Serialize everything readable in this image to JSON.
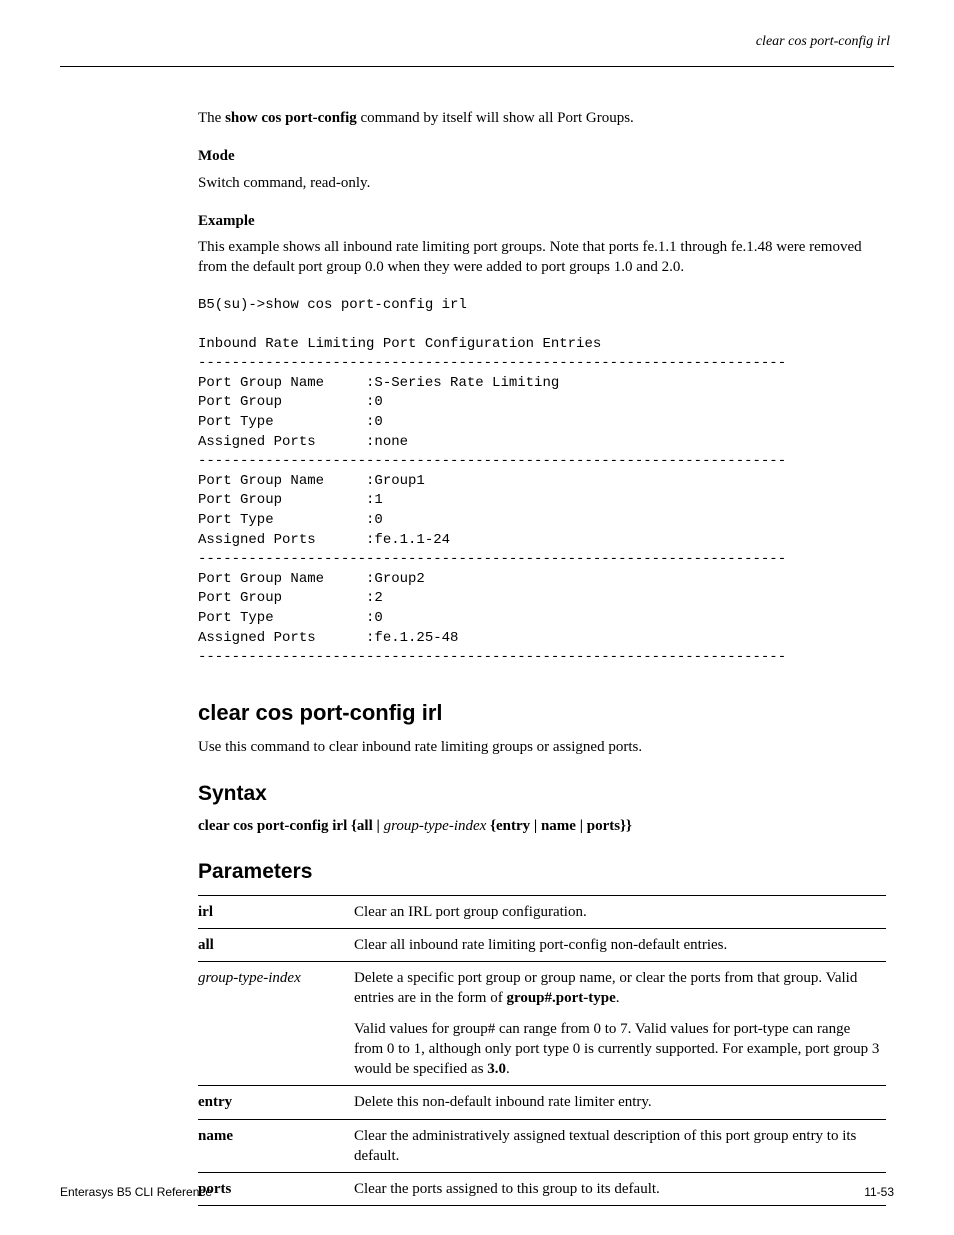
{
  "header": {
    "right": "clear cos port-config irl"
  },
  "body": {
    "intro_prefix": "The ",
    "intro_cmd": "show cos port-config",
    "intro_suffix": " command by itself will show all Port Groups.",
    "mode_h": "Mode",
    "mode_text": "Switch command, read-only.",
    "example_h": "Example",
    "example_text": "This example shows all inbound rate limiting port groups. Note that ports fe.1.1 through fe.1.48 were removed from the default port group 0.0 when they were added to port groups 1.0 and 2.0.",
    "code": "B5(su)->show cos port-config irl\n\nInbound Rate Limiting Port Configuration Entries\n----------------------------------------------------------------------\nPort Group Name     :S-Series Rate Limiting\nPort Group          :0\nPort Type           :0\nAssigned Ports      :none\n----------------------------------------------------------------------\nPort Group Name     :Group1\nPort Group          :1\nPort Type           :0\nAssigned Ports      :fe.1.1-24\n----------------------------------------------------------------------\nPort Group Name     :Group2\nPort Group          :2\nPort Type           :0\nAssigned Ports      :fe.1.25-48\n----------------------------------------------------------------------",
    "cmd_title": "clear cos port-config irl",
    "cmd_desc": "Use this command to clear inbound rate limiting groups or assigned ports.",
    "syntax_h": "Syntax",
    "syntax_prefix": "clear cos port-config irl ",
    "syntax_mid1": "{all | ",
    "syntax_var": "group-type-index",
    "syntax_mid2": " {entry | name | ports}}",
    "params_h": "Parameters"
  },
  "params": [
    {
      "term": "irl",
      "term_bold": true,
      "desc": "Clear an IRL port group configuration."
    },
    {
      "term": "all",
      "term_bold": true,
      "desc": "Clear all inbound rate limiting port-config non-default entries."
    },
    {
      "term": "group-type-index",
      "term_bold": false,
      "desc_prefix": "Delete a specific port group or group name, or clear the ports from that group. Valid entries are in the form of ",
      "desc_bold": "group#.port-type",
      "desc_suffix": ".",
      "extra_prefix": "Valid values for group# can range from 0 to 7. Valid values for port-type can range from 0 to 1, although only port type 0 is currently supported. For example, port group 3 would be specified as ",
      "extra_bold": "3.0",
      "extra_suffix": "."
    },
    {
      "term": "entry",
      "term_bold": true,
      "desc": "Delete this non-default inbound rate limiter entry."
    },
    {
      "term": "name",
      "term_bold": true,
      "desc": "Clear the administratively assigned textual description of this port group entry to its default."
    },
    {
      "term": "ports",
      "term_bold": true,
      "desc": "Clear the ports assigned to this group to its default."
    }
  ],
  "footer": {
    "left": "Enterasys B5 CLI Reference",
    "right": "11-53"
  }
}
